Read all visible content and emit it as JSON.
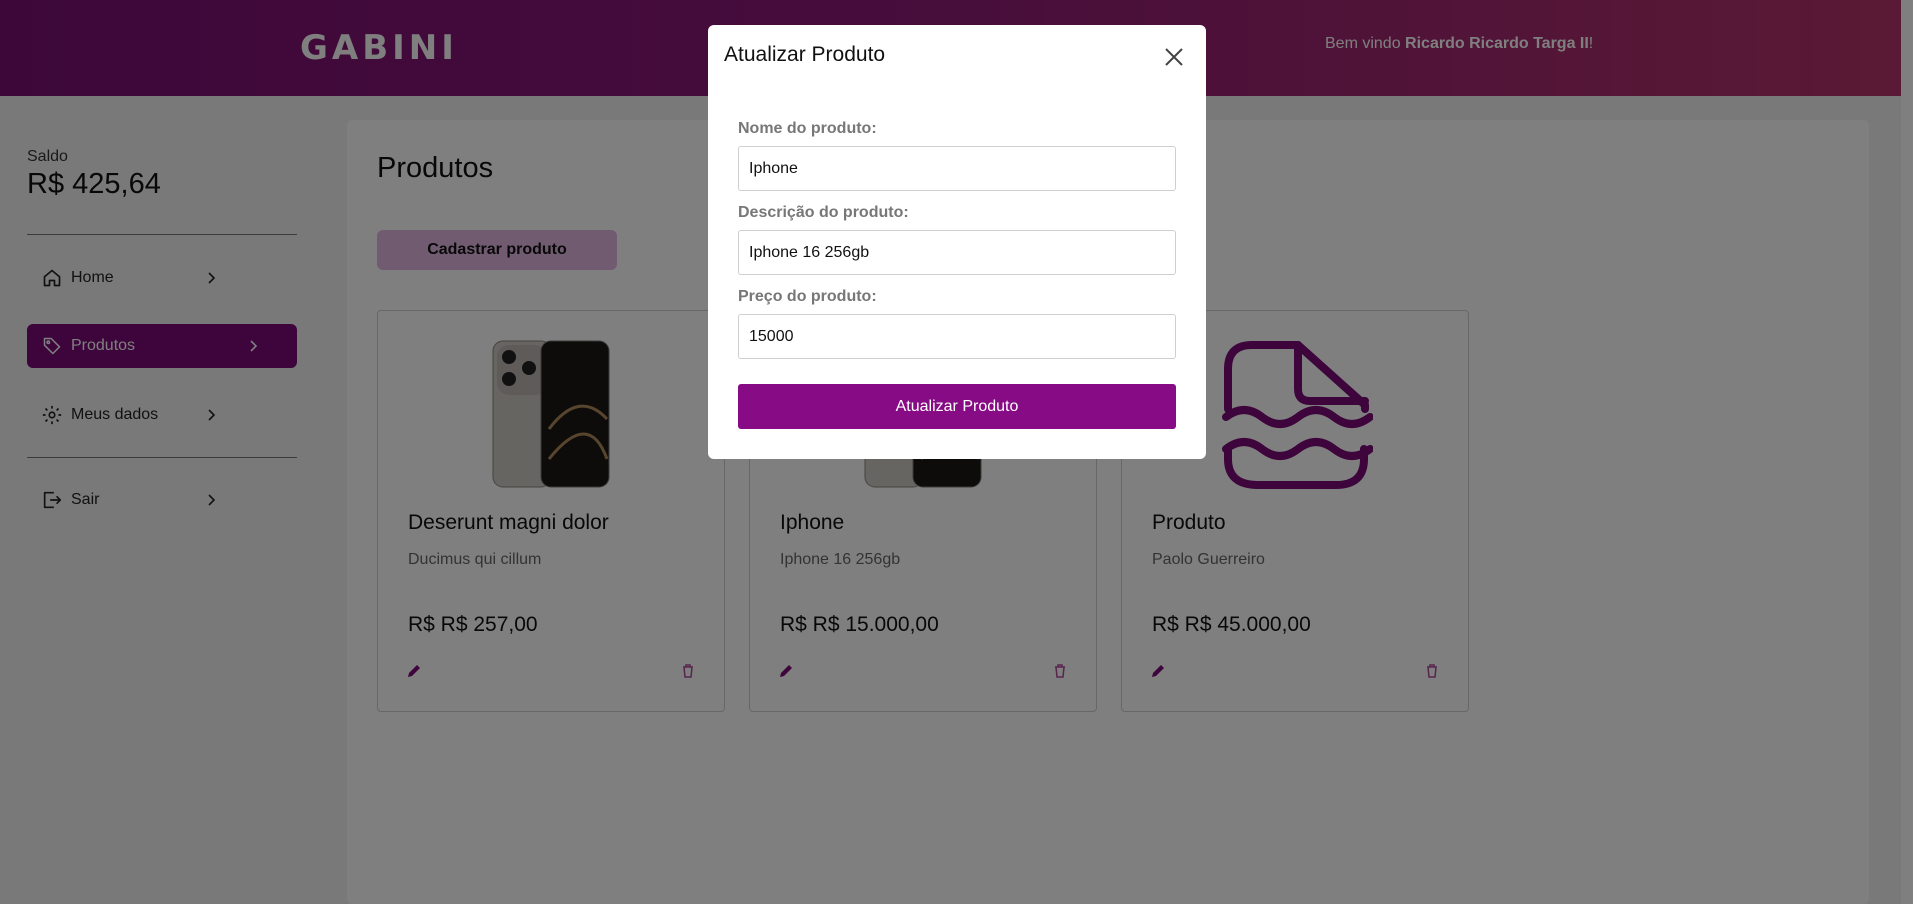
{
  "header": {
    "logo": "GABINI",
    "welcome_prefix": "Bem vindo ",
    "user_name": "Ricardo Ricardo Targa II",
    "welcome_suffix": "!"
  },
  "sidebar": {
    "balance_label": "Saldo",
    "balance_value": "R$ 425,64",
    "items": [
      {
        "label": "Home",
        "icon": "home-icon"
      },
      {
        "label": "Produtos",
        "icon": "tag-icon",
        "active": true
      },
      {
        "label": "Meus dados",
        "icon": "gear-icon"
      },
      {
        "label": "Sair",
        "icon": "logout-icon"
      }
    ]
  },
  "main": {
    "title": "Produtos",
    "add_button": "Cadastrar produto",
    "products": [
      {
        "name": "Deserunt magni dolor",
        "description": "Ducimus qui cillum",
        "price": "R$ R$ 257,00",
        "image": "iphone-image"
      },
      {
        "name": "Iphone",
        "description": "Iphone 16 256gb",
        "price": "R$ R$ 15.000,00",
        "image": "iphone-image"
      },
      {
        "name": "Produto",
        "description": "Paolo Guerreiro",
        "price": "R$ R$ 45.000,00",
        "image": "sandwich-icon"
      }
    ]
  },
  "modal": {
    "title": "Atualizar Produto",
    "name_label": "Nome do produto:",
    "name_value": "Iphone",
    "desc_label": "Descrição do produto:",
    "desc_value": "Iphone 16 256gb",
    "price_label": "Preço do produto:",
    "price_value": "15000",
    "submit_label": "Atualizar Produto"
  },
  "colors": {
    "brand": "#7a0a78",
    "button": "#870b85",
    "secondary_button": "#e2b6e1"
  }
}
